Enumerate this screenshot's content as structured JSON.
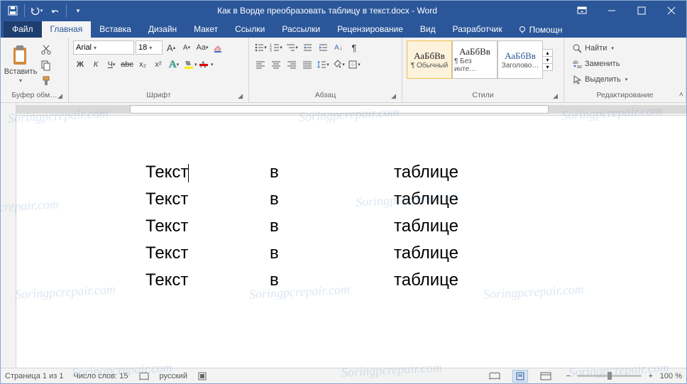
{
  "title": "Как в Ворде преобразовать таблицу в текст.docx - Word",
  "qat": {
    "save": "save",
    "undo": "undo",
    "redo": "redo",
    "customize": "customize"
  },
  "window_controls": {
    "min": "min",
    "max": "max",
    "close": "close",
    "ribbon_opts": "ribbon-display-options"
  },
  "tabs": {
    "file": "Файл",
    "items": [
      "Главная",
      "Вставка",
      "Дизайн",
      "Макет",
      "Ссылки",
      "Рассылки",
      "Рецензирование",
      "Вид",
      "Разработчик"
    ],
    "active_index": 0,
    "tellme": "Помощн"
  },
  "ribbon": {
    "clipboard": {
      "label": "Буфер обм…",
      "paste": "Вставить"
    },
    "font": {
      "label": "Шрифт",
      "name": "Arial",
      "size": "18",
      "bold": "Ж",
      "italic": "К",
      "underline": "Ч",
      "strike": "abc",
      "sub": "x₂",
      "sup": "x²"
    },
    "paragraph": {
      "label": "Абзац"
    },
    "styles": {
      "label": "Стили",
      "preview": "АаБбВв",
      "items": [
        "¶ Обычный",
        "¶ Без инте…",
        "Заголово…"
      ]
    },
    "editing": {
      "label": "Редактирование",
      "find": "Найти",
      "replace": "Заменить",
      "select": "Выделить"
    }
  },
  "document": {
    "rows": [
      [
        "Текст",
        "в",
        "таблице"
      ],
      [
        "Текст",
        "в",
        "таблице"
      ],
      [
        "Текст",
        "в",
        "таблице"
      ],
      [
        "Текст",
        "в",
        "таблице"
      ],
      [
        "Текст",
        "в",
        "таблице"
      ]
    ],
    "cursor_row": 0,
    "cursor_col": 0
  },
  "status": {
    "page": "Страница 1 из 1",
    "words": "Число слов: 15",
    "language": "русский",
    "zoom": "100 %"
  },
  "watermark": "Soringpcrepair.com"
}
